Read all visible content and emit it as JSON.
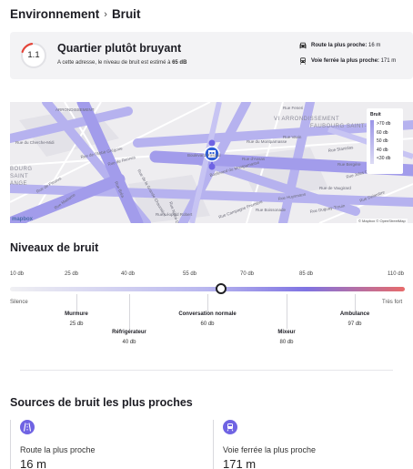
{
  "breadcrumb": {
    "parent": "Environnement",
    "separator": "›",
    "current": "Bruit"
  },
  "summary": {
    "score": "1.1",
    "title": "Quartier plutôt bruyant",
    "description_prefix": "A cette adresse, le niveau de bruit est estimé à",
    "description_value": "65 dB",
    "road_label": "Route la plus proche:",
    "road_value": "16 m",
    "rail_label": "Voie ferrée la plus proche:",
    "rail_value": "171 m",
    "gauge_fill": 0.11
  },
  "map": {
    "streets": [
      "ARRONDISSEMENT",
      "Rue Feneri",
      "Rue du Cherche-Midi",
      "Rue de l'Abbé Grégoire",
      "Rue de Rennes",
      "Boulevard du Montparnasse",
      "Rue Vavin",
      "Rue d'Assas",
      "Rue Notre-Dame-des-Champs",
      "Rue de la Grande Chaumière",
      "Rue Bréa",
      "Rue de Fleurus",
      "Rue Madame",
      "Rue Stanislas",
      "Rue Jules Chaplain",
      "Rue Huysmans",
      "Rue Duguay-Trouin",
      "Rue du Montparnasse",
      "Rue de Vaugirard",
      "Rue Campagne Première",
      "Boulevard Raspail",
      "Rue Léopold Robert",
      "Rue Delambre",
      "Rue Bergère",
      "Rue Boissonade",
      "VI ARRONDISSEMENT",
      "FAUBOURG SAINT-GERMAIN",
      "BOURG SAINT-GERMAIN",
      "BOURG",
      "SAINT",
      "ANGE",
      "Rue de Fleurus",
      "Rue Notre-Dame"
    ],
    "legend": {
      "title": "Bruit",
      "items": [
        ">70 db",
        "60 db",
        "50 db",
        "40 db",
        "<30 db"
      ]
    },
    "logo": "mapbox",
    "attribution": "© Mapbox © OpenStreetMap"
  },
  "levels": {
    "title": "Niveaux de bruit",
    "scale_labels": [
      "10 db",
      "25 db",
      "40 db",
      "55 db",
      "70 db",
      "85 db",
      "110 db"
    ],
    "current_db": 65,
    "left_label": "Silence",
    "right_label": "Très fort",
    "examples": [
      {
        "name": "Murmure",
        "value": "25 db"
      },
      {
        "name": "Réfrigérateur",
        "value": "40 db"
      },
      {
        "name": "Conversation normale",
        "value": "60 db"
      },
      {
        "name": "Mixeur",
        "value": "80 db"
      },
      {
        "name": "Ambulance",
        "value": "97 db"
      }
    ]
  },
  "sources": {
    "title": "Sources de bruit les plus proches",
    "items": [
      {
        "icon": "road-icon",
        "label": "Route la plus proche",
        "value": "16 m"
      },
      {
        "icon": "train-icon",
        "label": "Voie ferrée la plus proche",
        "value": "171 m"
      }
    ]
  },
  "colors": {
    "accent": "#6f63e3",
    "gauge_red": "#e4453a",
    "scale_end": "#e76b6b"
  }
}
